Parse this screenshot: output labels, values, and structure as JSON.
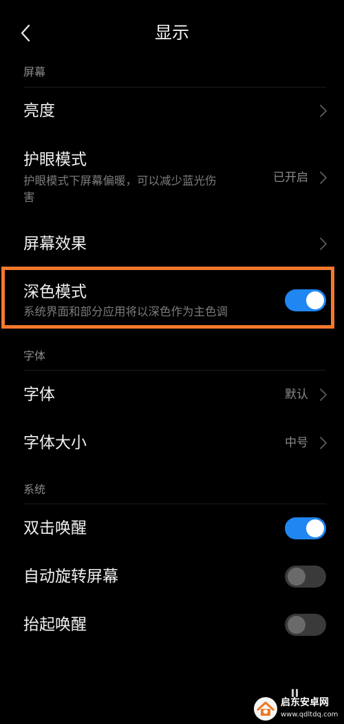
{
  "header": {
    "title": "显示",
    "back_icon": "back-arrow-icon"
  },
  "sections": {
    "screen": "屏幕",
    "font": "字体",
    "system": "系统"
  },
  "rows": {
    "brightness": {
      "title": "亮度"
    },
    "eye_care": {
      "title": "护眼模式",
      "desc_line1": "护眼模式下屏幕偏暖，可以减少蓝光伤",
      "desc_line2": "害",
      "value": "已开启"
    },
    "screen_effect": {
      "title": "屏幕效果"
    },
    "dark_mode": {
      "title": "深色模式",
      "desc": "系统界面和部分应用将以深色作为主色调",
      "enabled": true
    },
    "font": {
      "title": "字体",
      "value": "默认"
    },
    "font_size": {
      "title": "字体大小",
      "value": "中号"
    },
    "double_tap_wake": {
      "title": "双击唤醒",
      "enabled": true
    },
    "auto_rotate": {
      "title": "自动旋转屏幕",
      "enabled": false
    },
    "raise_to_wake": {
      "title": "抬起唤醒",
      "enabled": false
    }
  },
  "watermark": {
    "text": "启东安卓网",
    "url": "www.qdltdq.com"
  },
  "colors": {
    "background": "#000000",
    "toggle_on": "#1f86f2",
    "toggle_off": "#3a3a3a",
    "highlight": "#f4792d"
  }
}
